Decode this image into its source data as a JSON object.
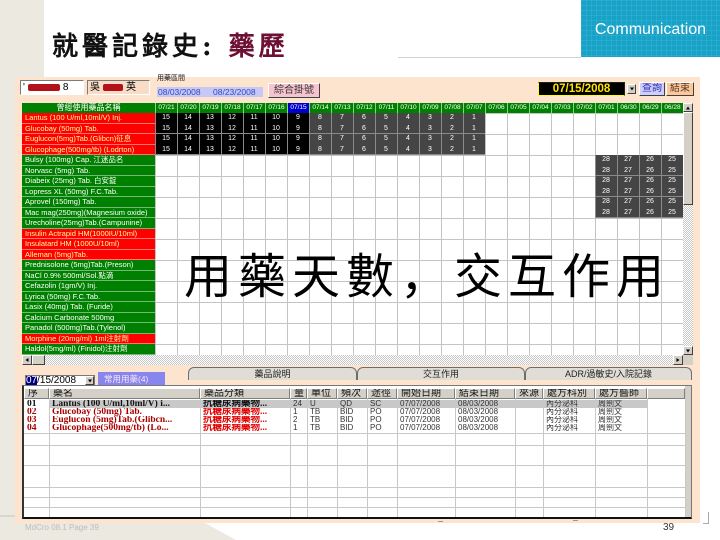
{
  "slide": {
    "title_main": "就醫記錄史: ",
    "title_highlight": "藥歷",
    "section_label": "Communication",
    "annotation": "用藥天數，交互作用",
    "footer_text": "MdCro 08.1  Page 39",
    "page_number": "39"
  },
  "colors": {
    "section_badge": "#17a2c8",
    "title_highlight": "#6d1033",
    "grid_header": "#008000",
    "selected_date": "#0000cc",
    "flag_red": "#ff0000",
    "flag_red_text": "#ffff99",
    "flag_green": "#008000",
    "cell_current": "#000000",
    "cell_past": "#454545",
    "order_red_name": "#a80000",
    "order_red_category": "#e00000",
    "common_meds_button": "#8686ee"
  },
  "icons": {
    "date_dropdown": "chevron-down-icon",
    "scroll_up": "arrow-up-icon",
    "scroll_down": "arrow-down-icon",
    "scroll_left": "arrow-left-icon",
    "scroll_right": "arrow-right-icon"
  },
  "toolbar": {
    "patient_id_prefix": "'",
    "patient_id_suffix": "8",
    "patient_name_prefix": "吳",
    "patient_name_suffix": "英",
    "date_range_label": "用藥區間",
    "date_range_start": "08/03/2008",
    "date_range_end": "08/23/2008",
    "register_button": "綜合掛號",
    "query_date": "07/15/2008",
    "query_button": "查詢",
    "exit_button": "結束"
  },
  "medication_grid": {
    "drug_column_header": "曾經使用藥品名稱",
    "selected_date": "07/15",
    "dates": [
      "07/21",
      "07/20",
      "07/19",
      "07/18",
      "07/17",
      "07/16",
      "07/15",
      "07/14",
      "07/13",
      "07/12",
      "07/11",
      "07/10",
      "07/09",
      "07/08",
      "07/07",
      "07/06",
      "07/05",
      "07/04",
      "07/03",
      "07/02",
      "07/01",
      "06/30",
      "06/29",
      "06/28"
    ],
    "rows": [
      {
        "name": "Lantus (100 U/ml,10ml/V) Inj.",
        "flag": "red",
        "days": {
          "07/21": 15,
          "07/20": 14,
          "07/19": 13,
          "07/18": 12,
          "07/17": 11,
          "07/16": 10,
          "07/15": 9,
          "07/14": 8,
          "07/13": 7,
          "07/12": 6,
          "07/11": 5,
          "07/10": 4,
          "07/09": 3,
          "07/08": 2,
          "07/07": 1
        }
      },
      {
        "name": "Glucobay (50mg) Tab.",
        "flag": "red",
        "days": {
          "07/21": 15,
          "07/20": 14,
          "07/19": 13,
          "07/18": 12,
          "07/17": 11,
          "07/16": 10,
          "07/15": 9,
          "07/14": 8,
          "07/13": 7,
          "07/12": 6,
          "07/11": 5,
          "07/10": 4,
          "07/09": 3,
          "07/08": 2,
          "07/07": 1
        }
      },
      {
        "name": "Euglucon(5mg)Tab.(Glibcn)征息",
        "flag": "red",
        "days": {
          "07/21": 15,
          "07/20": 14,
          "07/19": 13,
          "07/18": 12,
          "07/17": 11,
          "07/16": 10,
          "07/15": 9,
          "07/14": 8,
          "07/13": 7,
          "07/12": 6,
          "07/11": 5,
          "07/10": 4,
          "07/09": 3,
          "07/08": 2,
          "07/07": 1
        }
      },
      {
        "name": "Glucophage(500mg/tb) (Lodrton)",
        "flag": "red",
        "days": {
          "07/21": 15,
          "07/20": 14,
          "07/19": 13,
          "07/18": 12,
          "07/17": 11,
          "07/16": 10,
          "07/15": 9,
          "07/14": 8,
          "07/13": 7,
          "07/12": 6,
          "07/11": 5,
          "07/10": 4,
          "07/09": 3,
          "07/08": 2,
          "07/07": 1
        }
      },
      {
        "name": "Bulsy (100mg) Cap. 江迷品名",
        "flag": "green",
        "days": {
          "07/01": 28,
          "06/30": 27,
          "06/29": 26,
          "06/28": 25
        }
      },
      {
        "name": "Norvasc (5mg) Tab.",
        "flag": "green",
        "days": {
          "07/01": 28,
          "06/30": 27,
          "06/29": 26,
          "06/28": 25
        }
      },
      {
        "name": "Diabeix (25mg) Tab. 白安錠",
        "flag": "green",
        "days": {
          "07/01": 28,
          "06/30": 27,
          "06/29": 26,
          "06/28": 25
        }
      },
      {
        "name": "Lopress XL (50mg) F.C.Tab.",
        "flag": "green",
        "days": {
          "07/01": 28,
          "06/30": 27,
          "06/29": 26,
          "06/28": 25
        }
      },
      {
        "name": "Aprovel (150mg) Tab.",
        "flag": "green",
        "days": {
          "07/01": 28,
          "06/30": 27,
          "06/29": 26,
          "06/28": 25
        }
      },
      {
        "name": "Mac mag(250mg)(Magnesium oxide)",
        "flag": "green",
        "days": {
          "07/01": 28,
          "06/30": 27,
          "06/29": 26,
          "06/28": 25
        }
      },
      {
        "name": "Urecholine(25mg)Tab.(Campunine)",
        "flag": "green",
        "days": {}
      },
      {
        "name": "Insulin Actrapid HM(1000IU/10ml)",
        "flag": "red",
        "days": {}
      },
      {
        "name": "Insulatard HM (1000U/10ml)",
        "flag": "red",
        "days": {}
      },
      {
        "name": "Alleman (5mg)Tab.",
        "flag": "red",
        "days": {}
      },
      {
        "name": "Prednisolone (5mg)Tab.(Preson)",
        "flag": "green",
        "days": {}
      },
      {
        "name": "NaCl 0.9% 500ml/Sol.點滴",
        "flag": "green",
        "days": {}
      },
      {
        "name": "Cefazolin (1gm/V) Inj.",
        "flag": "green",
        "days": {}
      },
      {
        "name": "Lyrica (50mg) F.C.Tab.",
        "flag": "green",
        "days": {}
      },
      {
        "name": "Lasix (40mg) Tab. (Furide)",
        "flag": "green",
        "days": {}
      },
      {
        "name": "Calcium Carbonate 500mg",
        "flag": "green",
        "days": {}
      },
      {
        "name": "Panadol (500mg)Tab.(Tylenol)",
        "flag": "green",
        "days": {}
      },
      {
        "name": "Morphine (20mg/ml) 1ml注射劑",
        "flag": "red",
        "days": {}
      },
      {
        "name": "Haldol(5mg/ml) (Finidol)注射劑",
        "flag": "green",
        "days": {}
      }
    ]
  },
  "order_panel": {
    "date_selected_part": "07",
    "date_rest": "/15/2008",
    "common_meds_button": "常用用藥(4)",
    "tabs": [
      "藥品說明",
      "交互作用",
      "ADR/過敏史/入院記錄"
    ],
    "table": {
      "headers": {
        "no": "序",
        "name": "藥名",
        "category": "藥品分類",
        "dose": "量",
        "unit": "單位",
        "freq": "頻次",
        "route": "途徑",
        "start": "開始日期",
        "end": "結束日期",
        "source": "來源",
        "dept": "處方科別",
        "doctor": "處方醫師"
      },
      "rows": [
        {
          "no": "01",
          "name": "Lantus (100 U/ml,10ml/V) i...",
          "category": "抗糖尿病藥物...",
          "dose": "24",
          "unit": "U",
          "freq": "QD",
          "route": "SC",
          "start": "07/07/2008",
          "end": "08/03/2008",
          "source": "",
          "dept": "內分泌科",
          "doctor": "周劍文",
          "style": "red",
          "selected": true
        },
        {
          "no": "02",
          "name": "Glucobay (50mg) Tab.",
          "category": "抗糖尿病藥物...",
          "dose": "1",
          "unit": "TB",
          "freq": "BID",
          "route": "PO",
          "start": "07/07/2008",
          "end": "08/03/2008",
          "source": "",
          "dept": "內分泌科",
          "doctor": "周劍文",
          "style": "red",
          "selected": false
        },
        {
          "no": "03",
          "name": "Euglucon (5mg)Tab.(Glibcn...",
          "category": "抗糖尿病藥物...",
          "dose": "2",
          "unit": "TB",
          "freq": "BID",
          "route": "PO",
          "start": "07/07/2008",
          "end": "08/03/2008",
          "source": "",
          "dept": "內分泌科",
          "doctor": "周劍文",
          "style": "red",
          "selected": false
        },
        {
          "no": "04",
          "name": "Glucophage(500mg/tb) (Lo...",
          "category": "抗糖尿病藥物...",
          "dose": "1",
          "unit": "TB",
          "freq": "BID",
          "route": "PO",
          "start": "07/07/2008",
          "end": "08/03/2008",
          "source": "",
          "dept": "內分泌科",
          "doctor": "周劍文",
          "style": "red",
          "selected": false
        }
      ]
    }
  }
}
